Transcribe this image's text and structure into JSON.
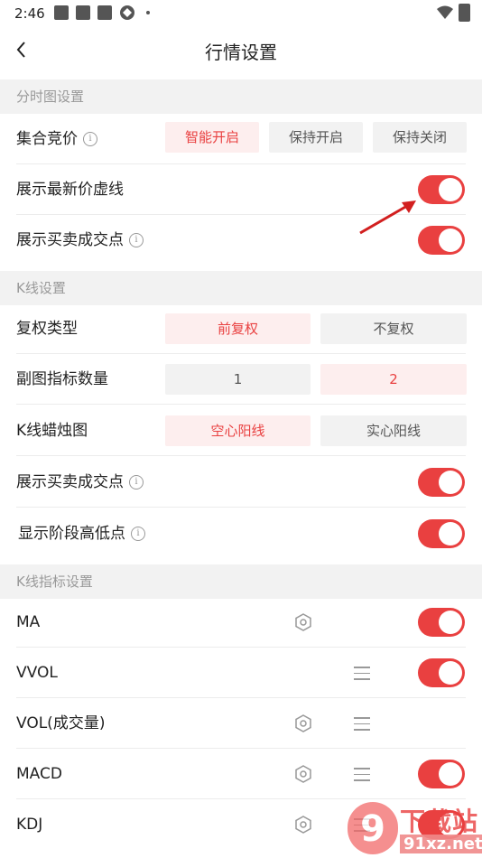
{
  "status": {
    "time": "2:46",
    "bullet": "•"
  },
  "header": {
    "title": "行情设置"
  },
  "sections": {
    "timeshare": "分时图设置",
    "kline": "K线设置",
    "indicators": "K线指标设置"
  },
  "timeshare": {
    "auction": {
      "label": "集合竞价",
      "options": [
        "智能开启",
        "保持开启",
        "保持关闭"
      ],
      "selected": "智能开启"
    },
    "latest_price_line": {
      "label": "展示最新价虚线",
      "on": true
    },
    "trade_points": {
      "label": "展示买卖成交点",
      "on": true
    }
  },
  "kline": {
    "adjust": {
      "label": "复权类型",
      "options": [
        "前复权",
        "不复权"
      ],
      "selected": "前复权"
    },
    "sub_count": {
      "label": "副图指标数量",
      "options": [
        "1",
        "2"
      ],
      "selected": "2"
    },
    "candle": {
      "label": "K线蜡烛图",
      "options": [
        "空心阳线",
        "实心阳线"
      ],
      "selected": "空心阳线"
    },
    "trade_points": {
      "label": "展示买卖成交点",
      "on": true
    },
    "stage_points": {
      "label": "显示阶段高低点",
      "on": true
    }
  },
  "indicators": [
    {
      "name": "MA",
      "on": true
    },
    {
      "name": "VVOL",
      "on": true
    },
    {
      "name": "VOL(成交量)",
      "on": false
    },
    {
      "name": "MACD",
      "on": true
    },
    {
      "name": "KDJ",
      "on": true
    }
  ],
  "info_glyph": "i",
  "watermark": {
    "logo": "9",
    "line1": "下载站",
    "line2": "91xz.net"
  },
  "colors": {
    "accent": "#e94040",
    "accent_bg": "#fdeeee",
    "section_bg": "#f2f2f2"
  }
}
